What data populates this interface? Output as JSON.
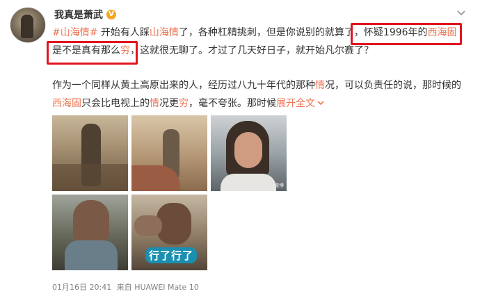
{
  "post": {
    "user": {
      "name": "我真是萧武",
      "verified_badge": "V"
    },
    "more_icon": "chevron-down-icon",
    "paragraph1": {
      "hashtag": "#山海情#",
      "t1": "开始有人踩",
      "link1": "山海情",
      "t2": "了，各种杠精挑刺，但是你说别的就算了，",
      "t3": "怀疑1996年的",
      "place": "西海固",
      "t4": "是不是真有那么",
      "qiong": "穷",
      "t5": "，这就很无聊了。才过了几天好日子，就开始凡尔赛了？"
    },
    "paragraph2": {
      "t1": "作为一个同样从黄土高原出来的人，经历过八九十年代的那种",
      "qing": "情",
      "t2": "况，可以负责任的说，那时候的",
      "place": "西海固",
      "t3": "只会比电视上的",
      "qing2": "情",
      "t4": "况更",
      "qiong": "穷",
      "t5": "，毫不夸张。那时候",
      "expand": "展开全文"
    },
    "images": {
      "caption": "行了行了",
      "watermark": "微博"
    },
    "meta": {
      "date": "01月16日 20:41",
      "source_prefix": "来自",
      "source": "HUAWEI Mate 10"
    }
  },
  "colors": {
    "highlight": "#eb7350",
    "box": "#e0141f",
    "badge": "#f5a623"
  }
}
